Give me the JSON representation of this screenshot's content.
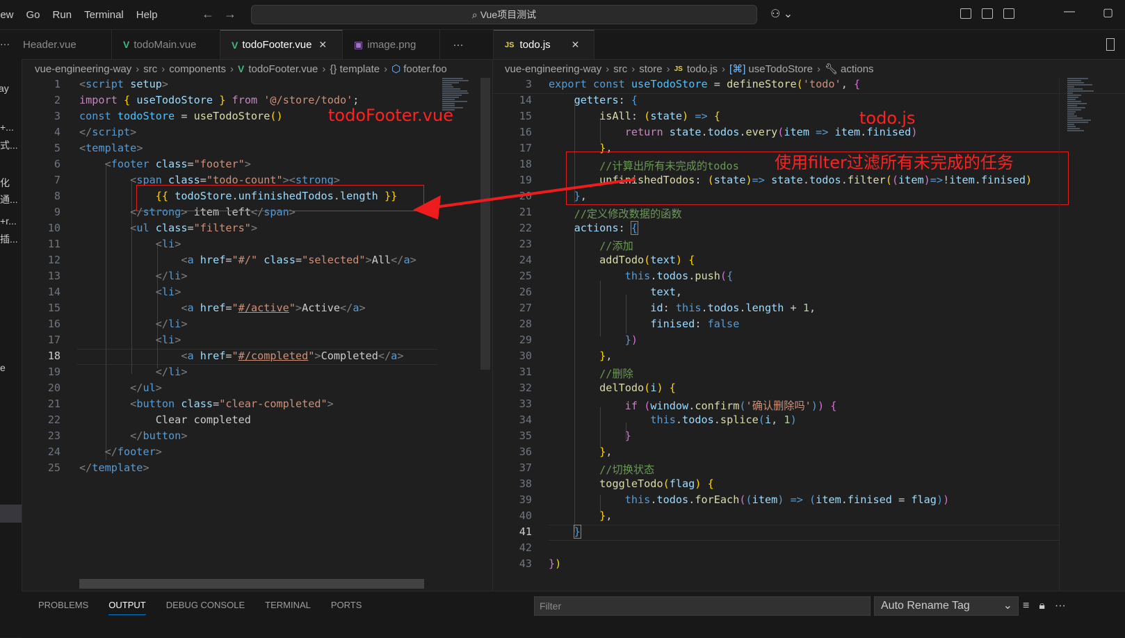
{
  "menu": [
    "iew",
    "Go",
    "Run",
    "Terminal",
    "Help"
  ],
  "search": {
    "label": "Vue项目测试"
  },
  "left_strip": [
    "ay",
    "+...",
    "式...",
    "化",
    "通...",
    "+r...",
    "插...",
    "e"
  ],
  "left_pane": {
    "tabs": [
      {
        "label": "Header.vue",
        "icon": "vue-icon"
      },
      {
        "label": "todoMain.vue",
        "icon": "vue-icon"
      },
      {
        "label": "todoFooter.vue",
        "icon": "vue-icon",
        "active": true
      },
      {
        "label": "image.png",
        "icon": "image-icon"
      }
    ],
    "more": "···",
    "breadcrumb": [
      "vue-engineering-way",
      "src",
      "components",
      "todoFooter.vue",
      "{} template",
      "footer.foo"
    ],
    "line_numbers": [
      "1",
      "2",
      "3",
      "4",
      "5",
      "6",
      "7",
      "8",
      "9",
      "10",
      "11",
      "12",
      "13",
      "14",
      "15",
      "16",
      "17",
      "18",
      "19",
      "20",
      "21",
      "22",
      "23",
      "24",
      "25"
    ],
    "current_line": "18",
    "annotation": "todoFooter.vue"
  },
  "right_pane": {
    "tab": {
      "label": "todo.js",
      "icon": "js-icon",
      "close": "✕"
    },
    "breadcrumb": [
      "vue-engineering-way",
      "src",
      "store",
      "todo.js",
      "useTodoStore",
      "actions"
    ],
    "line_numbers": [
      "3",
      "14",
      "15",
      "16",
      "17",
      "18",
      "19",
      "20",
      "21",
      "22",
      "23",
      "24",
      "25",
      "26",
      "27",
      "28",
      "29",
      "30",
      "31",
      "32",
      "33",
      "34",
      "35",
      "36",
      "37",
      "38",
      "39",
      "40",
      "41",
      "42",
      "43"
    ],
    "current_line": "41",
    "annotation_file": "todo.js",
    "annotation_note": "使用filter过滤所有未完成的任务"
  },
  "panel": {
    "tabs": [
      "PROBLEMS",
      "OUTPUT",
      "DEBUG CONSOLE",
      "TERMINAL",
      "PORTS"
    ],
    "active_tab": "OUTPUT",
    "filter_placeholder": "Filter",
    "output_channel": "Auto Rename Tag"
  },
  "colors": {
    "accent": "#0078d4",
    "annotation_red": "#ff2020",
    "vue_green": "#41b883",
    "js_yellow": "#e8d44d"
  }
}
